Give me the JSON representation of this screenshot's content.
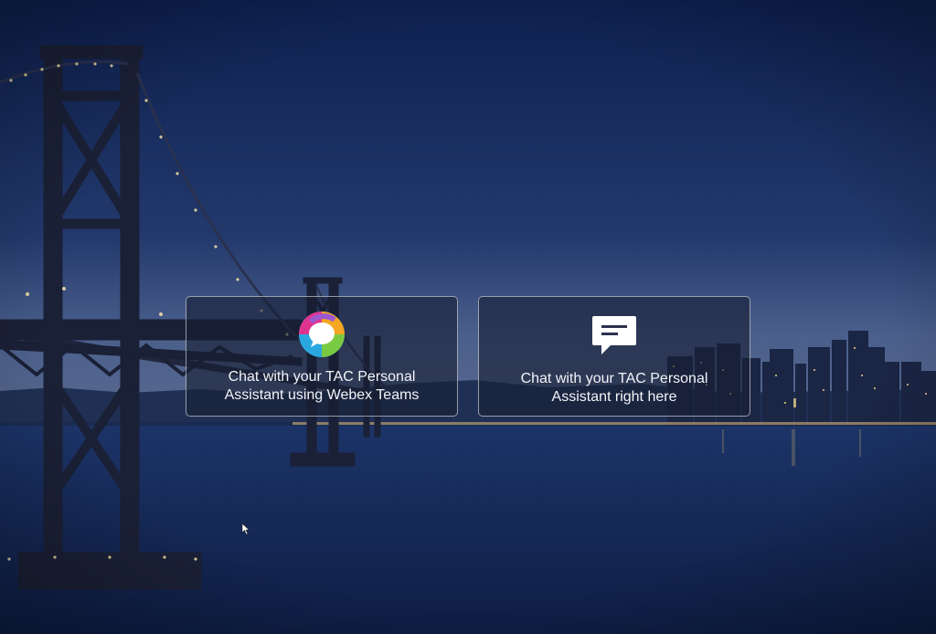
{
  "background": {
    "sky_top": "#0f2354",
    "sky_bottom": "#3d5584",
    "water": "#152a5c"
  },
  "cards": {
    "webex": {
      "icon": "webex-teams-icon",
      "label": "Chat with your TAC Personal Assistant using Webex Teams"
    },
    "web_chat": {
      "icon": "chat-bubble-icon",
      "label": "Chat with your TAC Personal Assistant right here"
    }
  }
}
